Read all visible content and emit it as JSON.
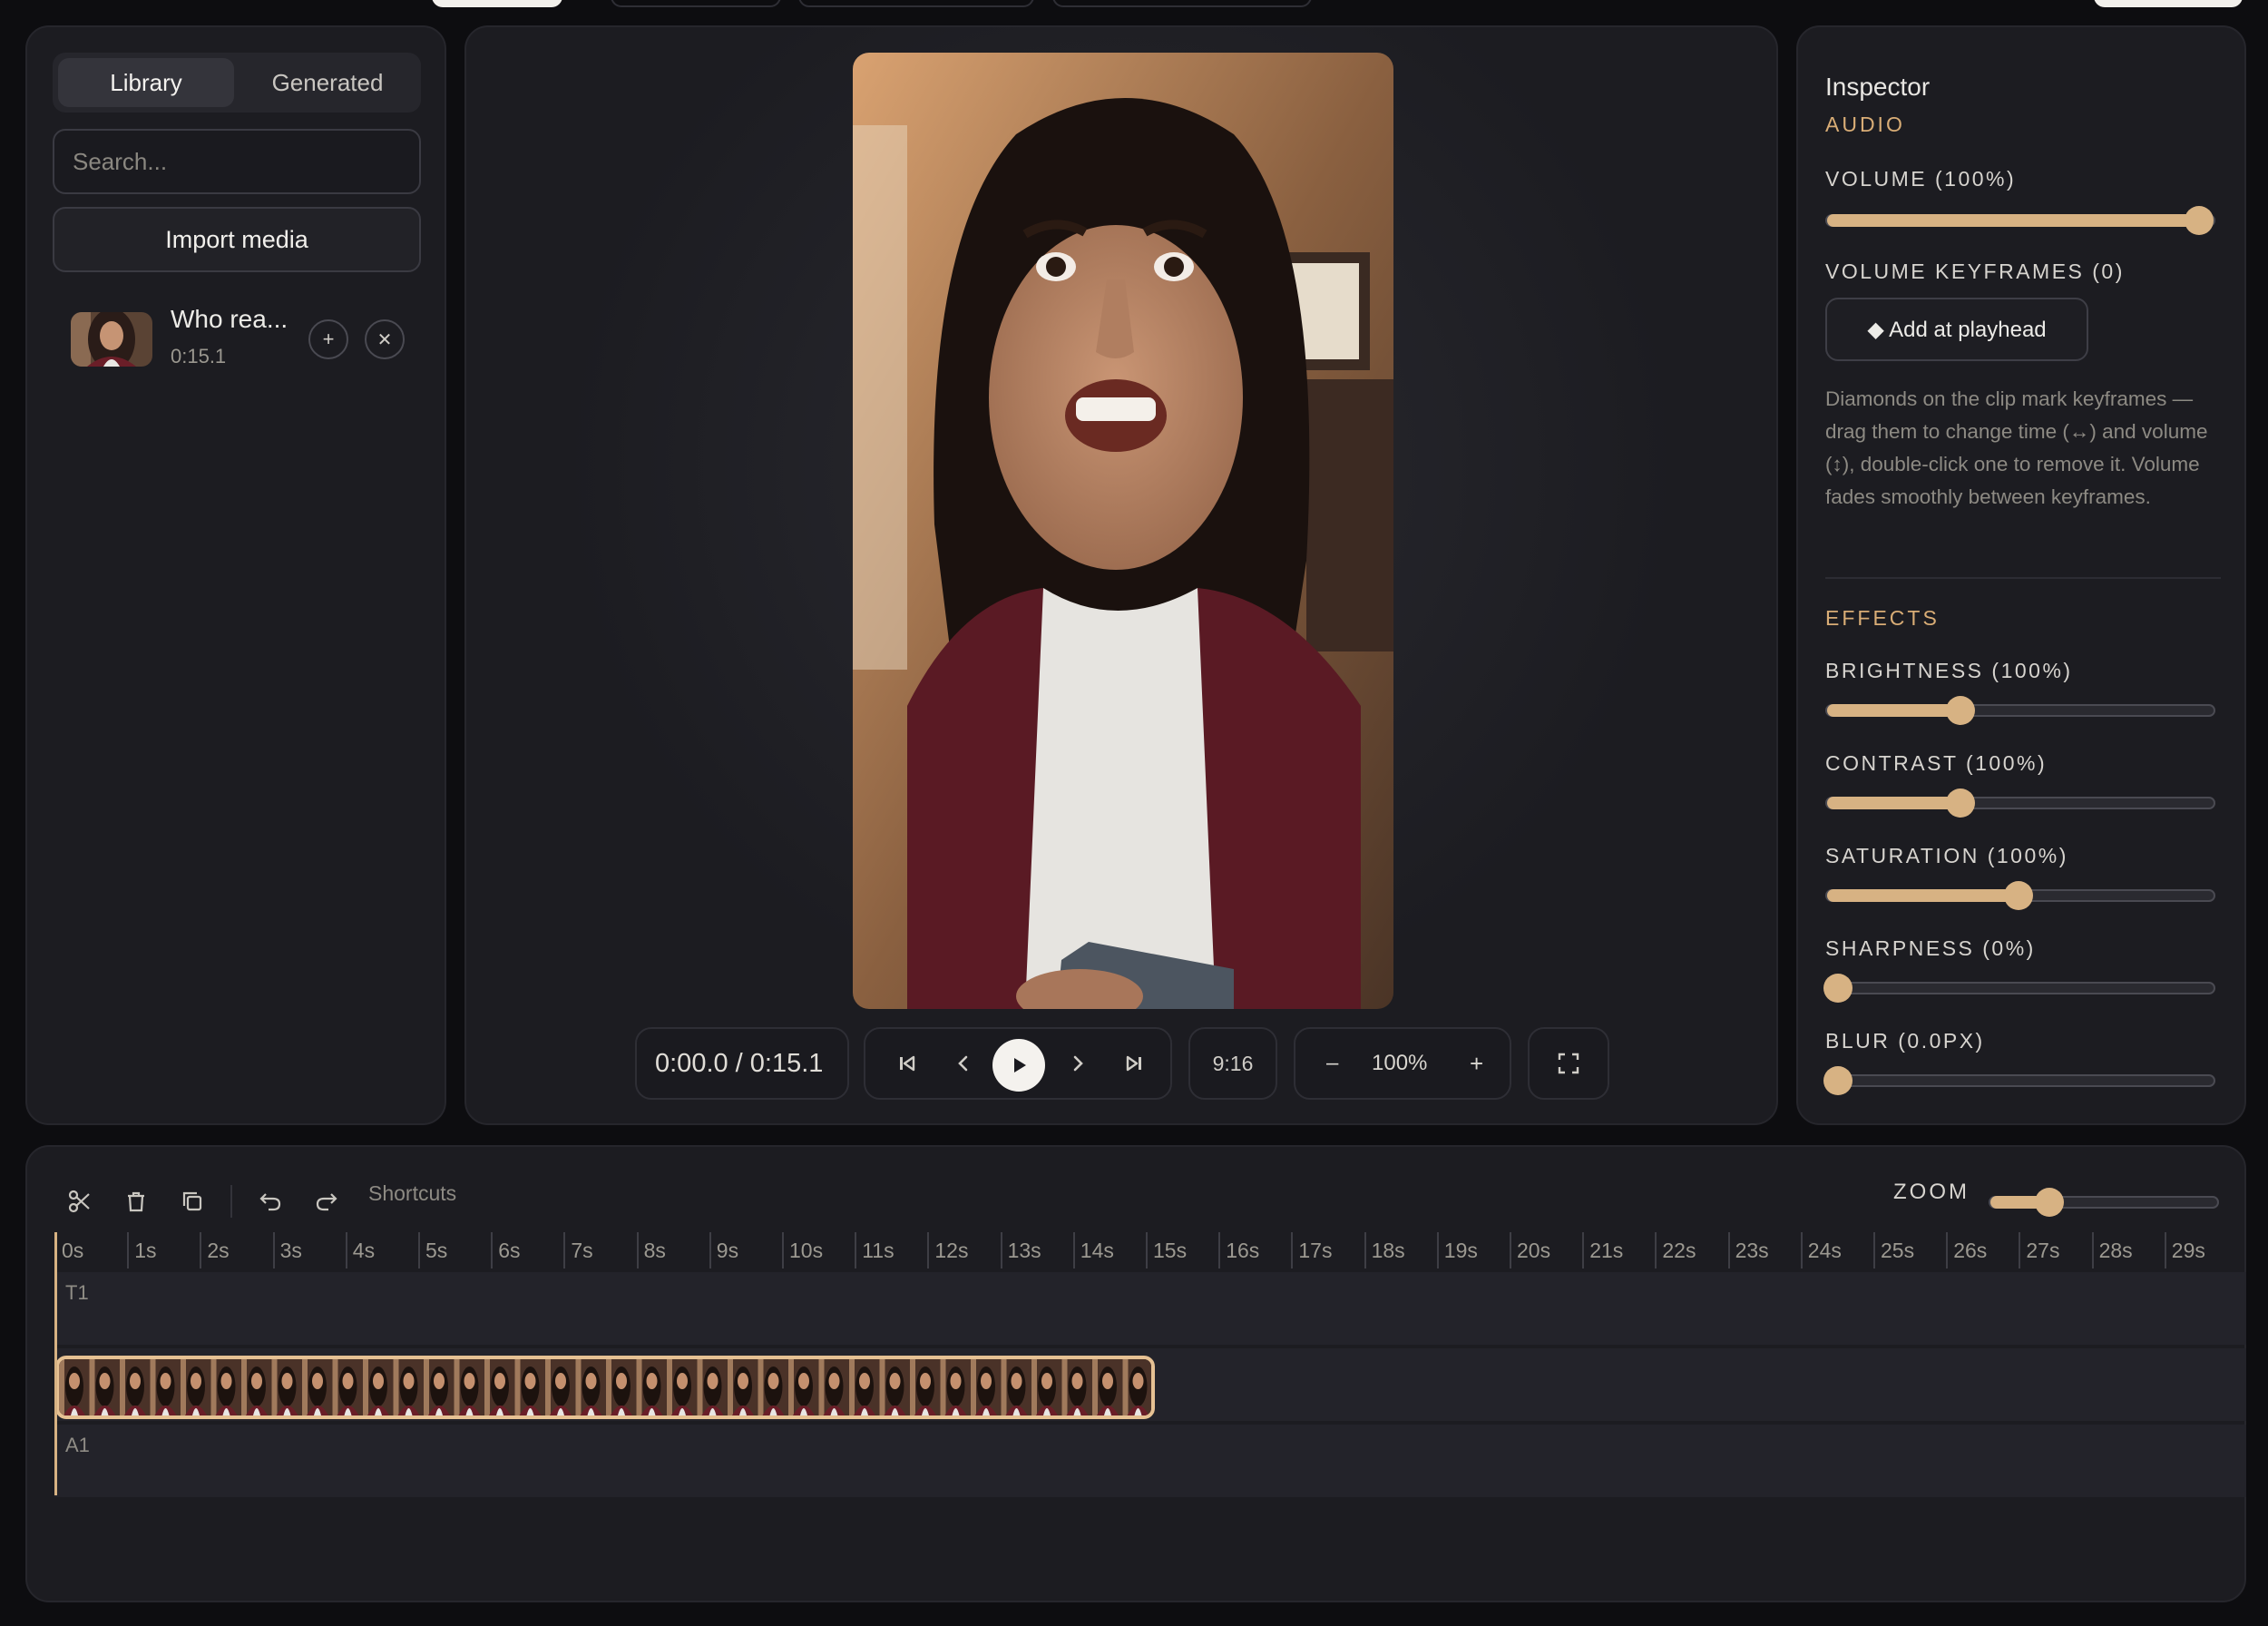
{
  "library": {
    "tabs": [
      {
        "label": "Library"
      },
      {
        "label": "Generated"
      }
    ],
    "search_placeholder": "Search...",
    "import_label": "Import media",
    "items": [
      {
        "name": "Who rea...",
        "duration": "0:15.1",
        "add_symbol": "+",
        "remove_symbol": "✕"
      }
    ]
  },
  "preview": {
    "timecode": "0:00.0 / 0:15.1",
    "aspect": "9:16",
    "zoom": "100%",
    "zoom_minus": "–",
    "zoom_plus": "+"
  },
  "inspector": {
    "title": "Inspector",
    "audio_section": "AUDIO",
    "volume_label": "VOLUME (100%)",
    "volume_value": 1.0,
    "keyframes_label": "VOLUME KEYFRAMES (0)",
    "add_keyframe": "◆ Add at playhead",
    "help_text": "Diamonds on the clip mark keyframes — drag them to change time (↔) and volume (↕), double-click one to remove it. Volume fades smoothly between keyframes.",
    "effects_section": "EFFECTS",
    "effects": [
      {
        "label": "BRIGHTNESS (100%)",
        "value": 0.34
      },
      {
        "label": "CONTRAST (100%)",
        "value": 0.34
      },
      {
        "label": "SATURATION (100%)",
        "value": 0.5
      },
      {
        "label": "SHARPNESS (0%)",
        "value": 0.0
      },
      {
        "label": "BLUR (0.0PX)",
        "value": 0.0
      }
    ]
  },
  "timeline": {
    "shortcuts_label": "Shortcuts",
    "zoom_label": "ZOOM",
    "zoom_value": 0.24,
    "ruler": [
      "0s",
      "1s",
      "2s",
      "3s",
      "4s",
      "5s",
      "6s",
      "7s",
      "8s",
      "9s",
      "10s",
      "11s",
      "12s",
      "13s",
      "14s",
      "15s",
      "16s",
      "17s",
      "18s",
      "19s",
      "20s",
      "21s",
      "22s",
      "23s",
      "24s",
      "25s",
      "26s",
      "27s",
      "28s",
      "29s"
    ],
    "tracks": [
      {
        "label": "T1"
      },
      {
        "label": "A1"
      }
    ],
    "colors": {
      "accent": "#d7b283",
      "clip_border": "#e6c193"
    }
  }
}
